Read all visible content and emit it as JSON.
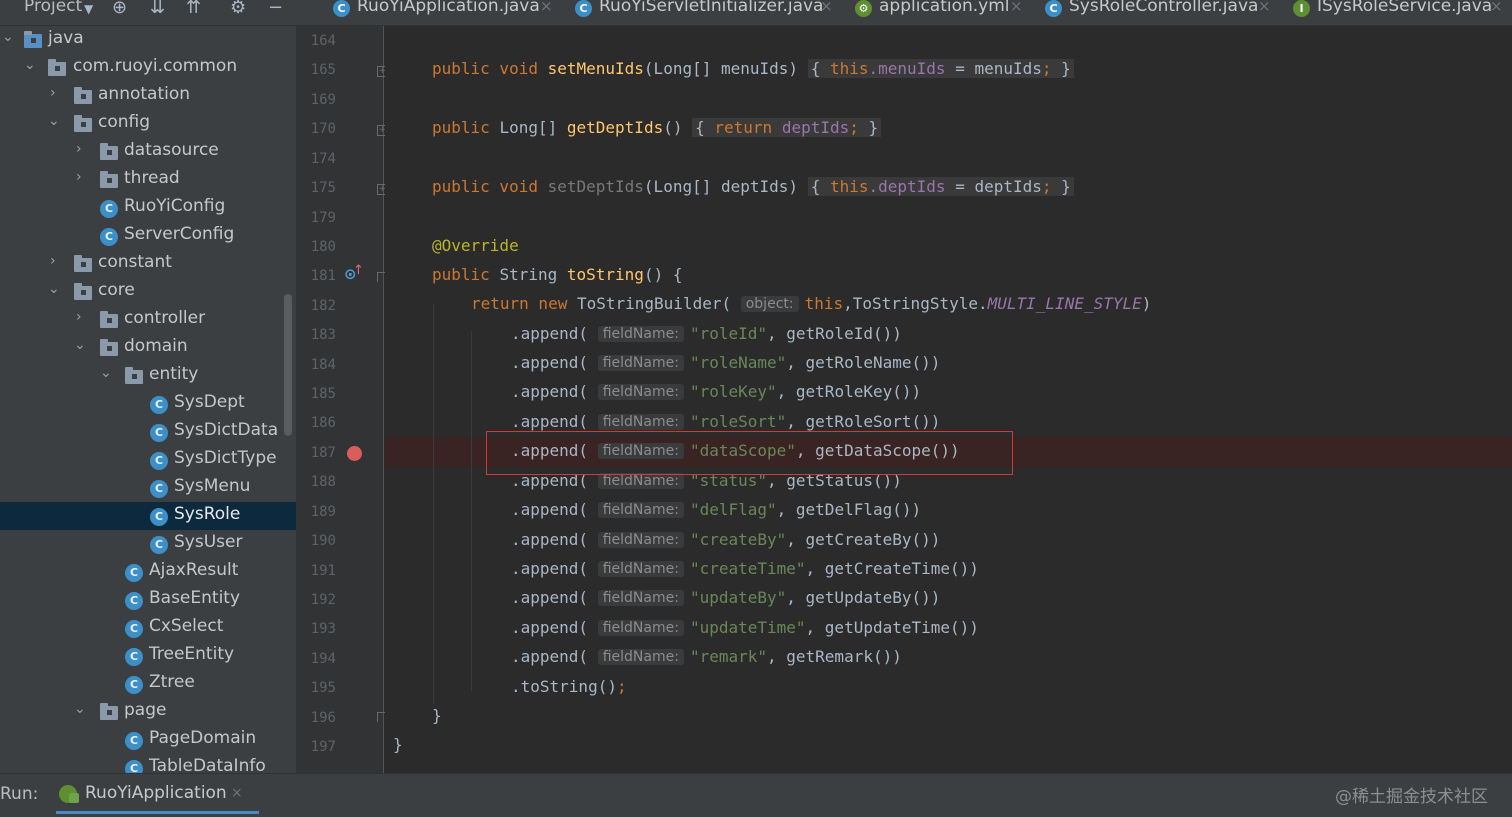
{
  "header": {
    "project_label": "Project",
    "tool_icons": [
      "crosshair-icon",
      "expand-all-icon",
      "collapse-all-icon",
      "gear-icon",
      "minimize-icon"
    ]
  },
  "tabs": [
    {
      "label": "RuoYiApplication.java",
      "icon_letter": "C"
    },
    {
      "label": "RuoYiServletInitializer.java",
      "icon_letter": "C"
    },
    {
      "label": "application.yml",
      "icon_letter": "⚙"
    },
    {
      "label": "SysRoleController.java",
      "icon_letter": "C"
    },
    {
      "label": "ISysRoleService.java",
      "icon_letter": "I"
    }
  ],
  "tree": [
    {
      "label": "java"
    },
    {
      "label": "com.ruoyi.common"
    },
    {
      "label": "annotation"
    },
    {
      "label": "config"
    },
    {
      "label": "datasource"
    },
    {
      "label": "thread"
    },
    {
      "label": "RuoYiConfig"
    },
    {
      "label": "ServerConfig"
    },
    {
      "label": "constant"
    },
    {
      "label": "core"
    },
    {
      "label": "controller"
    },
    {
      "label": "domain"
    },
    {
      "label": "entity"
    },
    {
      "label": "SysDept"
    },
    {
      "label": "SysDictData"
    },
    {
      "label": "SysDictType"
    },
    {
      "label": "SysMenu"
    },
    {
      "label": "SysRole",
      "selected": true
    },
    {
      "label": "SysUser"
    },
    {
      "label": "AjaxResult"
    },
    {
      "label": "BaseEntity"
    },
    {
      "label": "CxSelect"
    },
    {
      "label": "TreeEntity"
    },
    {
      "label": "Ztree"
    },
    {
      "label": "page"
    },
    {
      "label": "PageDomain"
    },
    {
      "label": "TableDataInfo"
    }
  ],
  "class_icon_letter": "C",
  "line_numbers": [
    "164",
    "165",
    "169",
    "170",
    "174",
    "175",
    "179",
    "180",
    "181",
    "182",
    "183",
    "184",
    "185",
    "186",
    "187",
    "188",
    "189",
    "190",
    "191",
    "192",
    "193",
    "194",
    "195",
    "196",
    "197"
  ],
  "code": {
    "l165": {
      "kw": "public void ",
      "fn": "setMenuIds",
      "p1": "(Long[] menuIds) ",
      "b1": "{",
      "kw2": " this",
      "f1": ".menuIds",
      "p2": " = menuIds",
      "s1": ";",
      "b2": " }"
    },
    "l170": {
      "kw": "public ",
      "t": "Long[] ",
      "fn": "getDeptIds",
      "p1": "() ",
      "b1": "{",
      "kw2": " return ",
      "f1": "deptIds",
      "s1": ";",
      "b2": " }"
    },
    "l175": {
      "kw": "public void ",
      "fn": "setDeptIds",
      "p1": "(Long[] deptIds) ",
      "b1": "{",
      "kw2": " this",
      "f1": ".deptIds",
      "p2": " = deptIds",
      "s1": ";",
      "b2": " }"
    },
    "l180": {
      "ann": "@Override"
    },
    "l181": {
      "kw": "public ",
      "t": "String ",
      "fn": "toString",
      "p1": "() {"
    },
    "l182": {
      "kw": "return new ",
      "t": "ToStringBuilder(",
      "hint": "object:",
      "kw2": "this",
      "p1": ",ToStringStyle.",
      "cst": "MULTI_LINE_STYLE",
      "p2": ")"
    },
    "appends": [
      {
        "str": "\"roleId\"",
        "call": ", getRoleId())"
      },
      {
        "str": "\"roleName\"",
        "call": ", getRoleName())"
      },
      {
        "str": "\"roleKey\"",
        "call": ", getRoleKey())"
      },
      {
        "str": "\"roleSort\"",
        "call": ", getRoleSort())"
      },
      {
        "str": "\"dataScope\"",
        "call": ", getDataScope())"
      },
      {
        "str": "\"status\"",
        "call": ", getStatus())"
      },
      {
        "str": "\"delFlag\"",
        "call": ", getDelFlag())"
      },
      {
        "str": "\"createBy\"",
        "call": ", getCreateBy())"
      },
      {
        "str": "\"createTime\"",
        "call": ", getCreateTime())"
      },
      {
        "str": "\"updateBy\"",
        "call": ", getUpdateBy())"
      },
      {
        "str": "\"updateTime\"",
        "call": ", getUpdateTime())"
      },
      {
        "str": "\"remark\"",
        "call": ", getRemark())"
      }
    ],
    "append_prefix": ".append(",
    "append_hint": "fieldName:",
    "l195": {
      "p1": ".toString()",
      "s1": ";"
    },
    "l196": "}",
    "l197": "}"
  },
  "run": {
    "label": "Run:",
    "tab_label": "RuoYiApplication",
    "close": "×"
  },
  "watermark": "@稀土掘金技术社区",
  "colors": {
    "keyword": "#cc7832",
    "method": "#ffc66d",
    "field": "#9876aa",
    "string": "#6a8759",
    "annotation": "#bbb529",
    "selection": "#0d293e",
    "breakpoint": "#db5c5c",
    "highlight_box": "#d03a3a"
  }
}
